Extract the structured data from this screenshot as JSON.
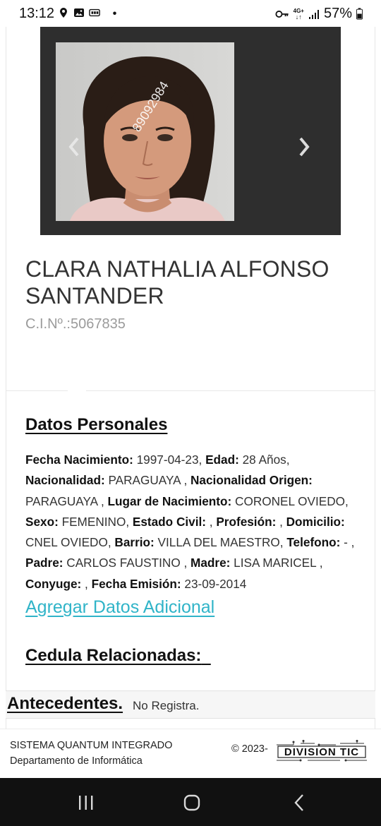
{
  "status_bar": {
    "time": "13:12",
    "network": "4G+",
    "battery": "57%",
    "icons": [
      "location-icon",
      "image-icon",
      "cast-icon",
      "dot-icon",
      "key-icon",
      "data-arrows-icon",
      "signal-icon",
      "battery-icon"
    ]
  },
  "carousel": {
    "photo_watermark": "89092984",
    "prev_icon": "chevron-left-icon",
    "next_icon": "chevron-right-icon"
  },
  "person": {
    "name": "CLARA NATHALIA ALFONSO SANTANDER",
    "ci_label": "C.I.Nº.:",
    "ci_number": "5067835"
  },
  "datos_personales": {
    "title": "Datos Personales",
    "fields": {
      "fecha_nacimiento_label": "Fecha Nacimiento:",
      "fecha_nacimiento": "1997-04-23",
      "edad_label": "Edad:",
      "edad": "28 Años",
      "nacionalidad_label": "Nacionalidad:",
      "nacionalidad": "PARAGUAYA",
      "nacionalidad_origen_label": "Nacionalidad Origen:",
      "nacionalidad_origen": "PARAGUAYA",
      "lugar_nacimiento_label": "Lugar de Nacimiento:",
      "lugar_nacimiento": "CORONEL OVIEDO",
      "sexo_label": "Sexo:",
      "sexo": "FEMENINO",
      "estado_civil_label": "Estado Civil:",
      "estado_civil": "",
      "profesion_label": "Profesión:",
      "profesion": "",
      "domicilio_label": "Domicilio:",
      "domicilio": "CNEL OVIEDO",
      "barrio_label": "Barrio:",
      "barrio": "VILLA DEL MAESTRO",
      "telefono_label": "Telefono:",
      "telefono": "-",
      "padre_label": "Padre:",
      "padre": "CARLOS FAUSTINO",
      "madre_label": "Madre:",
      "madre": "LISA MARICEL",
      "conyuge_label": "Conyuge:",
      "conyuge": "",
      "fecha_emision_label": "Fecha Emisión:",
      "fecha_emision": "23-09-2014"
    },
    "add_link": "Agregar Datos Adicional"
  },
  "cedulas": {
    "title": "Cedula Relacionadas:"
  },
  "antecedentes": {
    "title": "Antecedentes.",
    "value": "No Registra."
  },
  "footer": {
    "system_name": "SISTEMA QUANTUM INTEGRADO",
    "department": "Departamento de Informática",
    "copyright": "© 2023-",
    "logo_text": "DIVISION TIC"
  },
  "nav_bar": {
    "icons": [
      "recents-icon",
      "home-icon",
      "back-icon"
    ]
  },
  "colors": {
    "link": "#30b4c8",
    "carousel_bg": "#2e2e2e",
    "nav_bar_bg": "#111111",
    "ci_text": "#9b9b9b"
  }
}
